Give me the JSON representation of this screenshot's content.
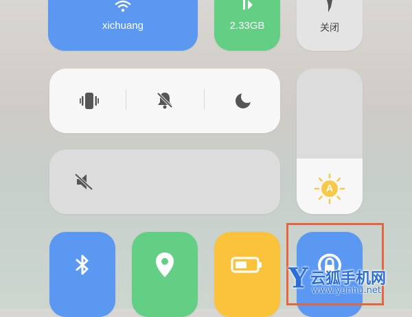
{
  "top_tiles": {
    "wifi_label": "xichuang",
    "data_label": "2.33GB",
    "flashlight_label": "关闭"
  },
  "colors": {
    "wifi": "#5a98f2",
    "data": "#62cf85",
    "bluetooth": "#5a98f2",
    "location": "#62cf85",
    "battery": "#fbc33c",
    "rotation_lock": "#5a98f2",
    "watermark_box": "#e8643a"
  },
  "sound_modes": {
    "vibrate_icon": "vibrate-icon",
    "mute_icon": "bell-off-icon",
    "dnd_icon": "moon-icon"
  },
  "volume": {
    "icon": "speaker-mute-icon"
  },
  "brightness": {
    "icon": "auto-brightness-icon",
    "badge": "A",
    "level": 0.38
  },
  "bottom_row": [
    "bluetooth-icon",
    "location-icon",
    "battery-saver-icon",
    "rotation-lock-icon"
  ],
  "watermark": {
    "logo_letter": "Y",
    "site_name": "云狐手机网",
    "url": "www.yunhu.net"
  }
}
